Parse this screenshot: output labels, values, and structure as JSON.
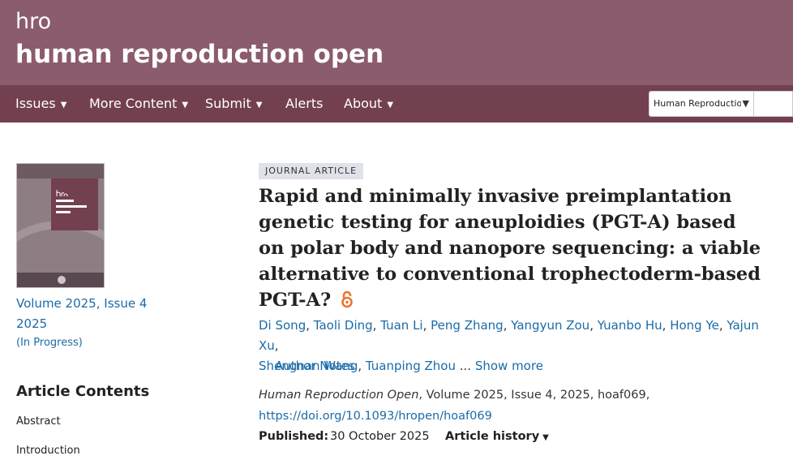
{
  "header": {
    "logo_text": "hro",
    "site_title": "human reproduction open",
    "colors": {
      "header_bg": "#8b5b6e",
      "nav_bg": "#73404f",
      "link": "#1a6ba8",
      "oa_orange": "#e8772e"
    }
  },
  "nav": {
    "items": [
      {
        "label": "Issues",
        "has_dropdown": true
      },
      {
        "label": "More Content",
        "has_dropdown": true
      },
      {
        "label": "Submit",
        "has_dropdown": true
      },
      {
        "label": "Alerts",
        "has_dropdown": false
      },
      {
        "label": "About",
        "has_dropdown": true
      }
    ],
    "search_scope": "Human Reproductio",
    "search_value": ""
  },
  "sidebar": {
    "volume": "Volume 2025, Issue 4",
    "year": "2025",
    "status": "(In Progress)",
    "contents_title": "Article Contents",
    "contents_items": [
      "Abstract",
      "Introduction"
    ]
  },
  "article": {
    "type_badge": "JOURNAL ARTICLE",
    "title": "Rapid and minimally invasive preimplantation genetic testing for aneuploidies (PGT-A) based on polar body and nanopore sequencing: a viable alternative to conventional trophectoderm-based PGT-A?",
    "open_access_icon": "open-access-icon",
    "authors": [
      "Di Song",
      "Taoli Ding",
      "Tuan Li",
      "Peng Zhang",
      "Yangyun Zou",
      "Yuanbo Hu",
      "Hong Ye",
      "Yajun Xu",
      "Shengnan Wang",
      "Tuanping Zhou"
    ],
    "ellipsis": "...",
    "show_more": "Show more",
    "author_notes": "Author Notes",
    "journal": "Human Reproduction Open",
    "citation_rest": ", Volume 2025, Issue 4, 2025, hoaf069,",
    "doi": "https://doi.org/10.1093/hropen/hoaf069",
    "published_label": "Published:",
    "published_date": "30 October 2025",
    "history_label": "Article history"
  }
}
